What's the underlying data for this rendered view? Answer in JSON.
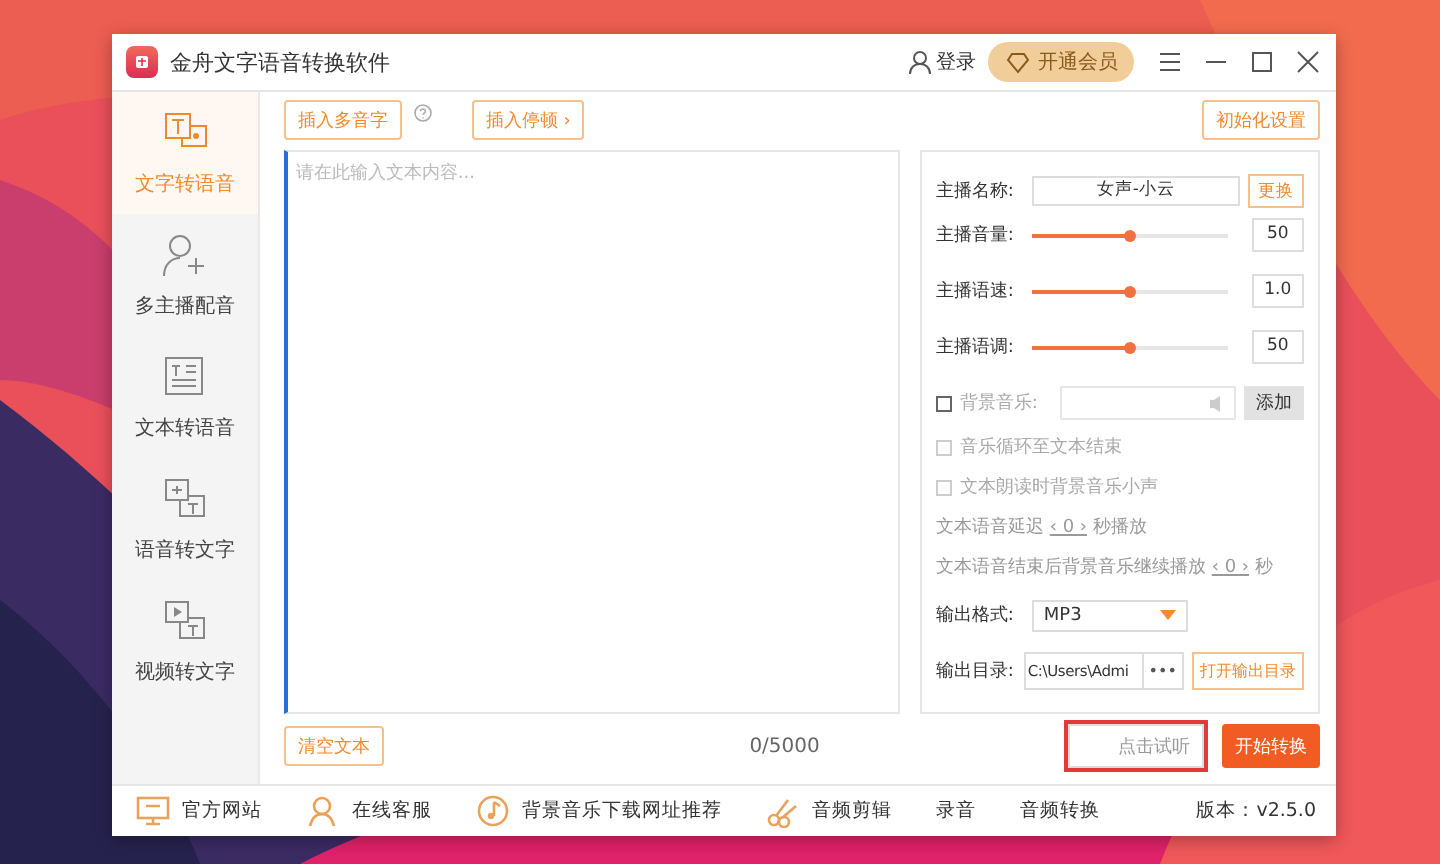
{
  "app": {
    "title": "金舟文字语音转换软件",
    "login": "登录",
    "vip": "开通会员"
  },
  "sidebar": {
    "items": [
      {
        "label": "文字转语音",
        "selected": true,
        "kind": "text-voice"
      },
      {
        "label": "多主播配音",
        "selected": false,
        "kind": "add-person"
      },
      {
        "label": "文本转语音",
        "selected": false,
        "kind": "document"
      },
      {
        "label": "语音转文字",
        "selected": false,
        "kind": "voice-text"
      },
      {
        "label": "视频转文字",
        "selected": false,
        "kind": "video-text"
      }
    ]
  },
  "toolbar": {
    "buttons": [
      "插入多音字",
      "插入停顿 ›"
    ],
    "reset": "初始化设置"
  },
  "editor": {
    "placeholder": "请在此输入文本内容...",
    "clear": "清空文本",
    "counter": "0/5000"
  },
  "settings": {
    "anchor_label": "主播名称:",
    "anchor_value": "女声-小云",
    "change": "更换",
    "sliders": [
      {
        "label": "主播音量:",
        "level": 0.5,
        "value": "50"
      },
      {
        "label": "主播语速:",
        "level": 0.5,
        "value": "1.0"
      },
      {
        "label": "主播语调:",
        "level": 0.5,
        "value": "50"
      }
    ],
    "options": [
      {
        "kind": "music",
        "label": "背景音乐:",
        "checked": false,
        "disabled": false,
        "button": "添加"
      },
      {
        "kind": "check",
        "label": "音乐循环至文本结束",
        "checked": false,
        "disabled": true
      },
      {
        "kind": "check",
        "label": "文本朗读时背景音乐小声",
        "checked": false,
        "disabled": true
      }
    ],
    "delays": [
      {
        "before": "文本语音延迟",
        "value": "‹ 0 ›",
        "after": "秒播放"
      },
      {
        "before": "文本语音结束后背景音乐继续播放",
        "value": "‹ 0 ›",
        "after": "秒"
      }
    ],
    "format": {
      "label": "输出格式:",
      "value": "MP3"
    },
    "output": {
      "label": "输出目录:",
      "value": "C:\\Users\\Admi",
      "browse": "•••",
      "open": "打开输出目录"
    }
  },
  "actions": {
    "preview": "点击试听",
    "highlighted": true,
    "start": "开始转换"
  },
  "footer": {
    "links": [
      {
        "label": "官方网站",
        "kind": "monitor"
      },
      {
        "label": "在线客服",
        "kind": "person"
      },
      {
        "label": "背景音乐下载网址推荐",
        "kind": "music"
      },
      {
        "label": "音频剪辑",
        "kind": "scissors"
      },
      {
        "label": "录音",
        "kind": "none"
      },
      {
        "label": "音频转换",
        "kind": "none"
      }
    ],
    "version": "版本：v2.5.0"
  }
}
